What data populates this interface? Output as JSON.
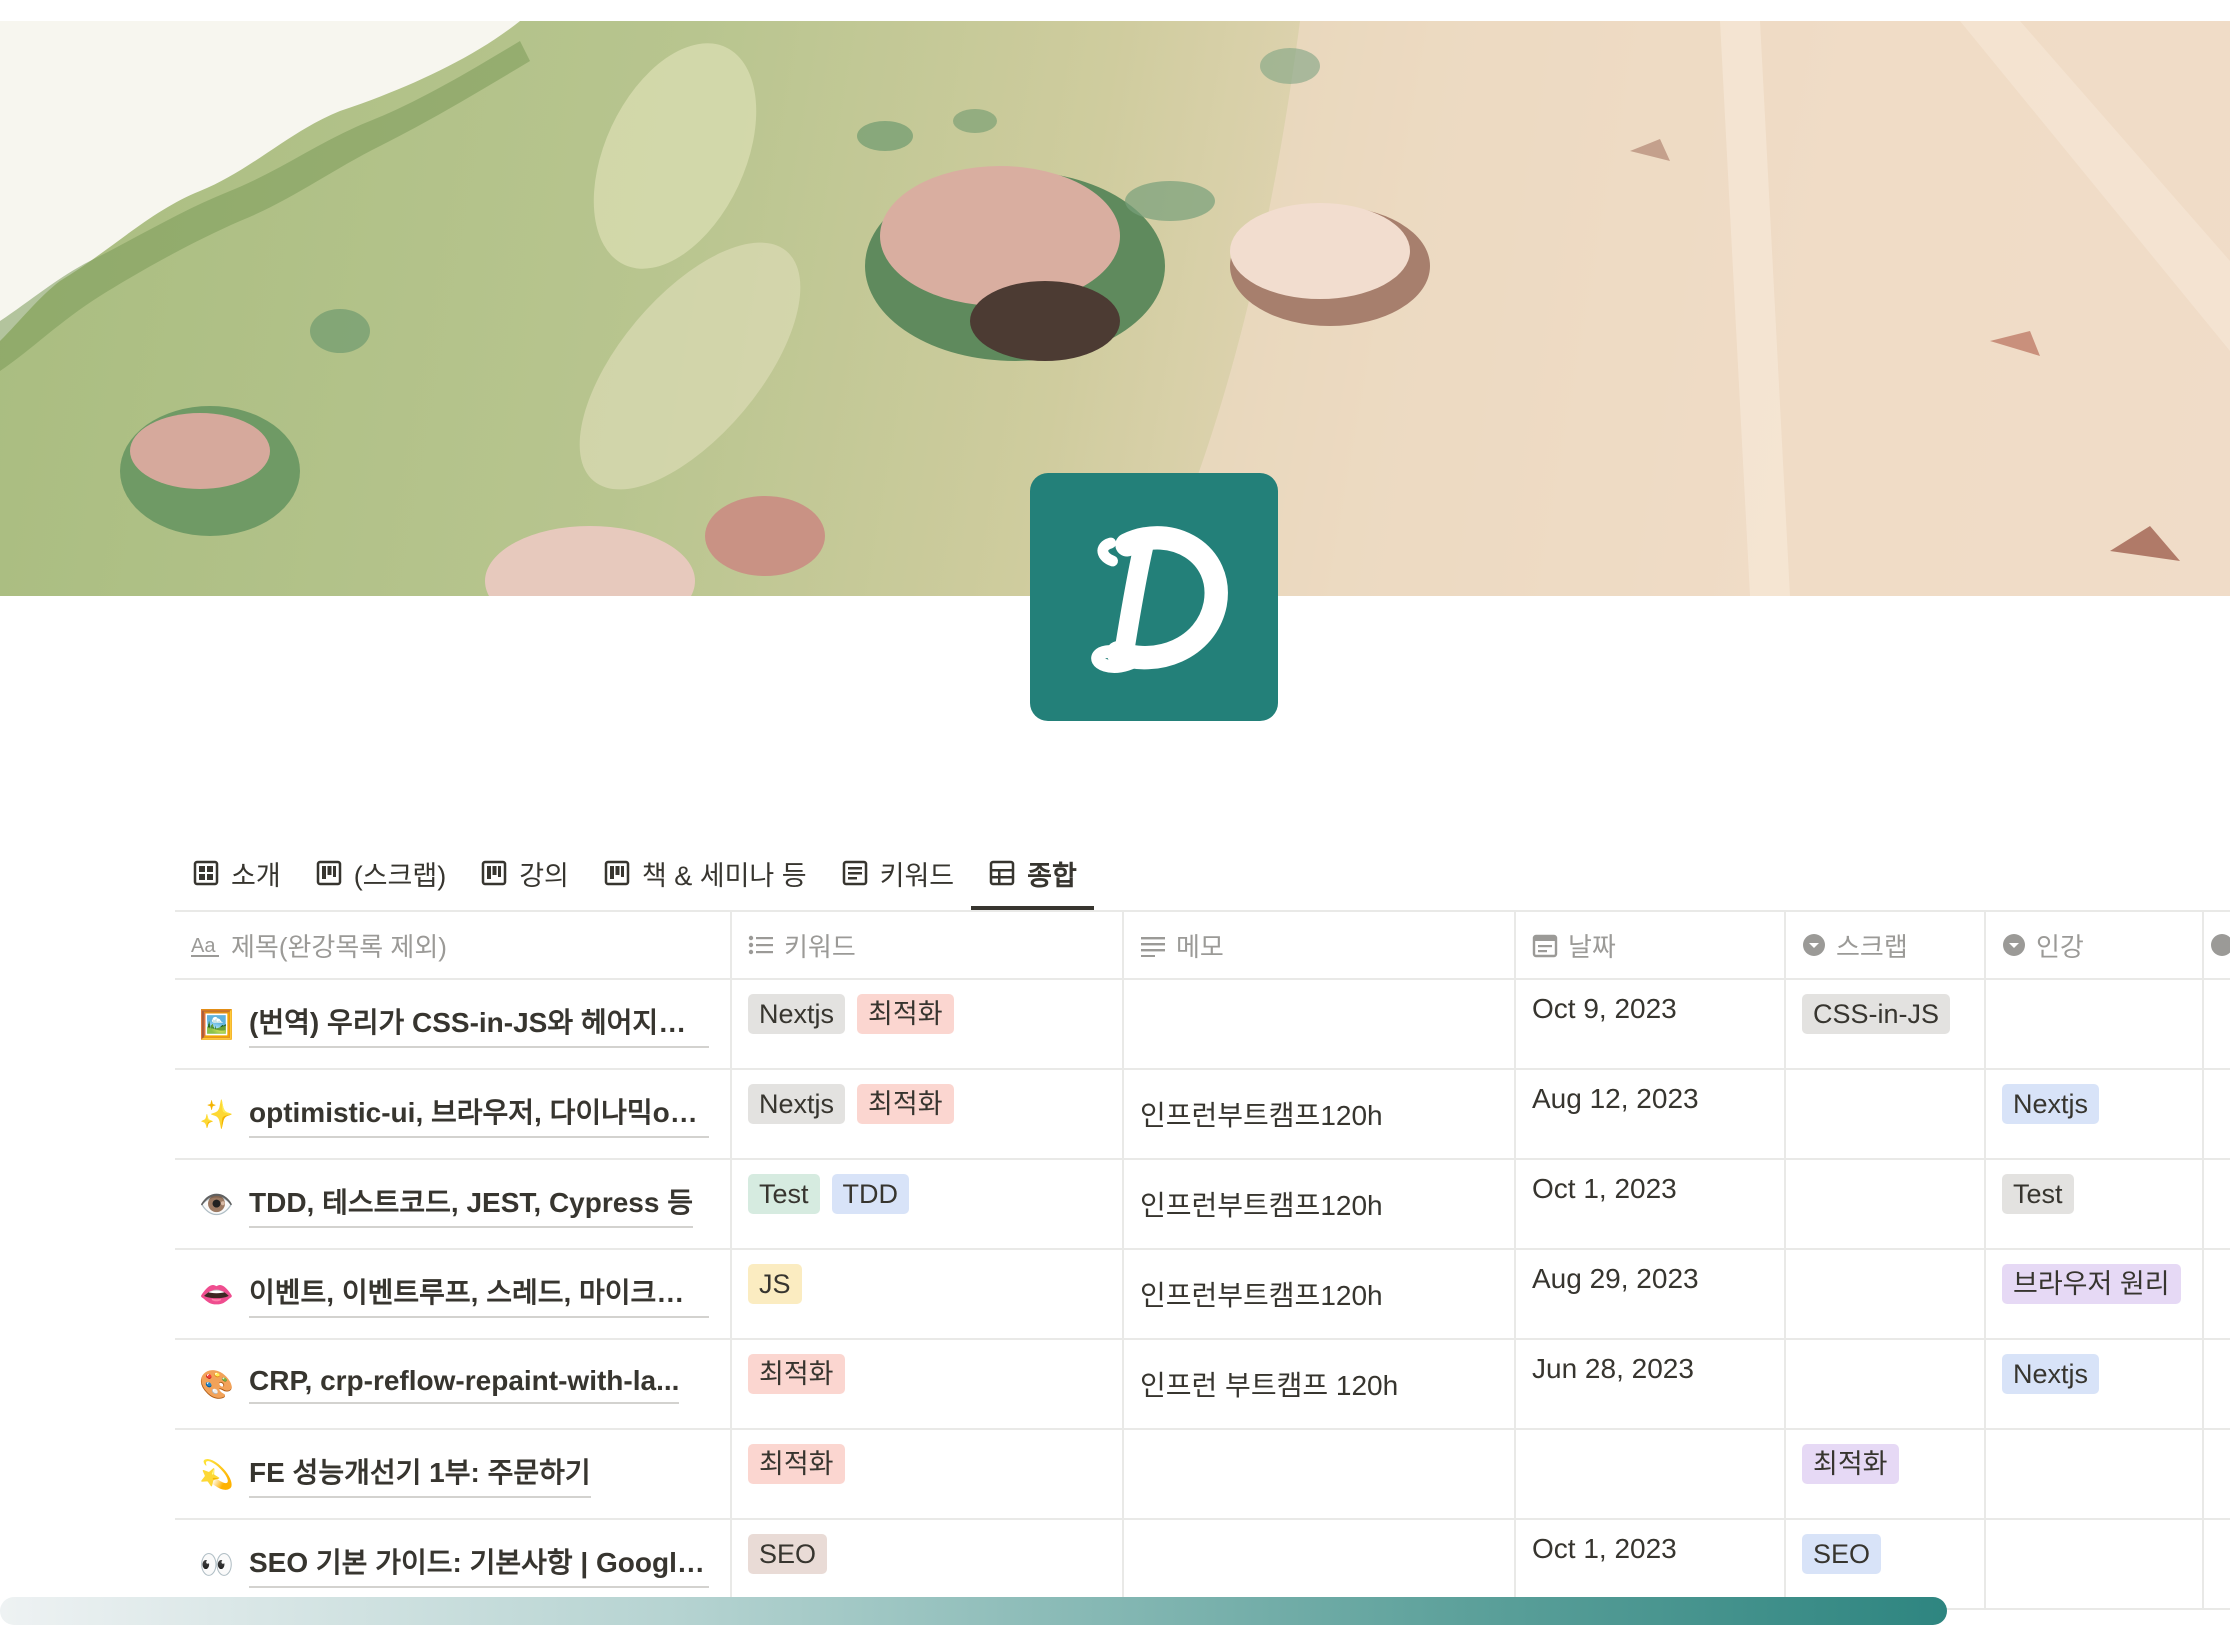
{
  "cover": {
    "colors": [
      "#a9bd80",
      "#efdcc6"
    ]
  },
  "page_icon": {
    "letter": "D",
    "color": "#238079"
  },
  "tabs": [
    {
      "label": "소개",
      "icon": "gallery-icon"
    },
    {
      "label": "(스크랩)",
      "icon": "board-icon"
    },
    {
      "label": "강의",
      "icon": "board-icon"
    },
    {
      "label": "책 & 세미나 등",
      "icon": "board-icon"
    },
    {
      "label": "키워드",
      "icon": "list-icon"
    },
    {
      "label": "종합",
      "icon": "table-icon",
      "active": true
    }
  ],
  "columns": {
    "title": {
      "label": "제목(완강목록 제외)",
      "icon": "text-property-icon"
    },
    "keyword": {
      "label": "키워드",
      "icon": "multiselect-property-icon"
    },
    "memo": {
      "label": "메모",
      "icon": "text-lines-icon"
    },
    "date": {
      "label": "날짜",
      "icon": "calendar-icon"
    },
    "scrap": {
      "label": "스크랩",
      "icon": "select-property-icon"
    },
    "lecture": {
      "label": "인강",
      "icon": "select-property-icon"
    }
  },
  "rows": [
    {
      "icon": "🖼️",
      "title": "(번역) 우리가 CSS-in-JS와 헤어지는 ...",
      "keywords": [
        {
          "label": "Nextjs",
          "color": "gray"
        },
        {
          "label": "최적화",
          "color": "red"
        }
      ],
      "memo": "",
      "date": "Oct 9, 2023",
      "scrap": {
        "label": "CSS-in-JS",
        "color": "gray"
      },
      "lecture": null
    },
    {
      "icon": "✨",
      "title": "optimistic-ui, 브라우저, 다이나믹og,...",
      "keywords": [
        {
          "label": "Nextjs",
          "color": "gray"
        },
        {
          "label": "최적화",
          "color": "red"
        }
      ],
      "memo": "인프런부트캠프120h",
      "date": "Aug 12, 2023",
      "scrap": null,
      "lecture": {
        "label": "Nextjs",
        "color": "blue"
      }
    },
    {
      "icon": "👁️",
      "title": "TDD, 테스트코드, JEST, Cypress 등",
      "keywords": [
        {
          "label": "Test",
          "color": "green"
        },
        {
          "label": "TDD",
          "color": "blue"
        }
      ],
      "memo": "인프런부트캠프120h",
      "date": "Oct 1, 2023",
      "scrap": null,
      "lecture": {
        "label": "Test",
        "color": "gray"
      }
    },
    {
      "icon": "👄",
      "title": "이벤트, 이벤트루프, 스레드, 마이크로~...",
      "keywords": [
        {
          "label": "JS",
          "color": "yellow"
        }
      ],
      "memo": "인프런부트캠프120h",
      "date": "Aug 29, 2023",
      "scrap": null,
      "lecture": {
        "label": "브라우저 원리",
        "color": "purple"
      }
    },
    {
      "icon": "🎨",
      "title": "CRP, crp-reflow-repaint-with-la...",
      "keywords": [
        {
          "label": "최적화",
          "color": "red"
        }
      ],
      "memo": "인프런 부트캠프 120h",
      "date": "Jun 28, 2023",
      "scrap": null,
      "lecture": {
        "label": "Nextjs",
        "color": "blue"
      }
    },
    {
      "icon": "💫",
      "title": "FE 성능개선기 1부: 주문하기",
      "keywords": [
        {
          "label": "최적화",
          "color": "red"
        }
      ],
      "memo": "",
      "date": "",
      "scrap": {
        "label": "최적화",
        "color": "purple"
      },
      "lecture": null
    },
    {
      "icon": "👀",
      "title": "SEO 기본 가이드: 기본사항 | Google ...",
      "keywords": [
        {
          "label": "SEO",
          "color": "brown"
        }
      ],
      "memo": "",
      "date": "Oct 1, 2023",
      "scrap": {
        "label": "SEO",
        "color": "blue"
      },
      "lecture": null
    }
  ],
  "scrollbar": {
    "colors": [
      "#eef2f3",
      "#2e8580"
    ]
  }
}
